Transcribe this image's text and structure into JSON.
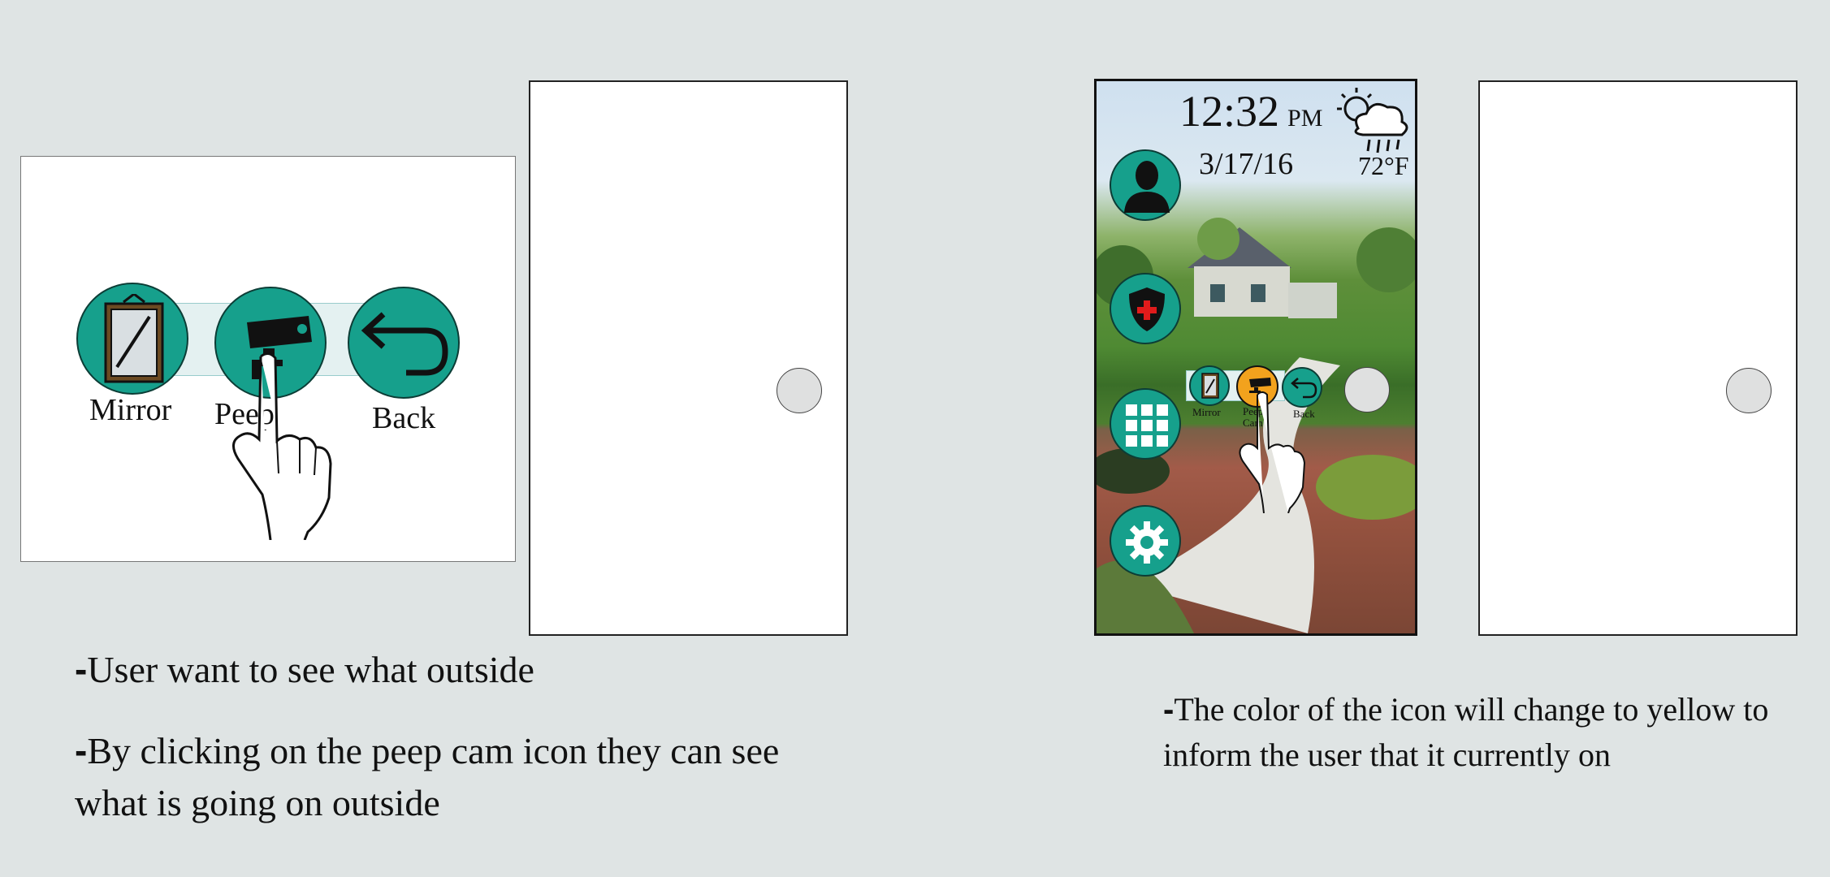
{
  "left_scene": {
    "mirror_label": "Mirror",
    "peep_label": "Peep",
    "back_label": "Back"
  },
  "phone": {
    "time": "12:32",
    "ampm": "PM",
    "date": "3/17/16",
    "temperature": "72°F",
    "mirror_label": "Mirror",
    "peep_label": "Peep Cam",
    "back_label": "Back"
  },
  "captions": {
    "left_line1": "User want to see what outside",
    "left_line2a": "By clicking on the peep cam icon they can see",
    "left_line2b": "what is going on outside",
    "right_line1a": "The color of the icon will change to yellow to",
    "right_line1b": "inform the user that it currently on"
  },
  "colors": {
    "teal": "#16a08c",
    "active_yellow": "#f2a21d",
    "background": "#dfe4e4"
  }
}
